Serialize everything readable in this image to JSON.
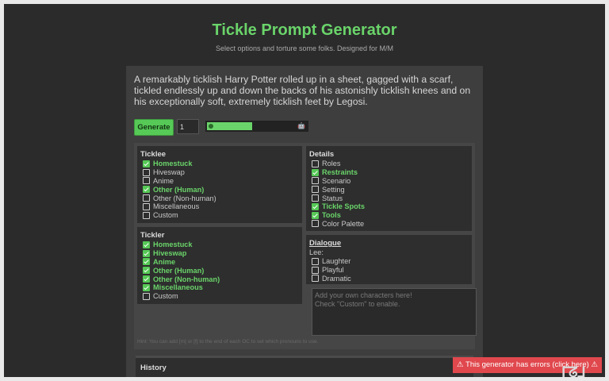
{
  "header": {
    "title": "Tickle Prompt Generator",
    "subtitle": "Select options and torture some folks. Designed for M/M"
  },
  "output": {
    "text": "A remarkably ticklish Harry Potter rolled up in a sheet, gagged with a scarf, tickled endlessly up and down the backs of his astonishly ticklish knees and on his exceptionally soft, extremely ticklish feet by Legosi."
  },
  "controls": {
    "generate_label": "Generate",
    "count_value": "1",
    "progress_fraction": 0.45
  },
  "ticklee": {
    "heading": "Ticklee",
    "items": [
      {
        "label": "Homestuck",
        "checked": true
      },
      {
        "label": "Hiveswap",
        "checked": false
      },
      {
        "label": "Anime",
        "checked": false
      },
      {
        "label": "Other (Human)",
        "checked": true
      },
      {
        "label": "Other (Non-human)",
        "checked": false
      },
      {
        "label": "Miscellaneous",
        "checked": false
      },
      {
        "label": "Custom",
        "checked": false
      }
    ]
  },
  "tickler": {
    "heading": "Tickler",
    "items": [
      {
        "label": "Homestuck",
        "checked": true
      },
      {
        "label": "Hiveswap",
        "checked": true
      },
      {
        "label": "Anime",
        "checked": true
      },
      {
        "label": "Other (Human)",
        "checked": true
      },
      {
        "label": "Other (Non-human)",
        "checked": true
      },
      {
        "label": "Miscellaneous",
        "checked": true
      },
      {
        "label": "Custom",
        "checked": false
      }
    ]
  },
  "details": {
    "heading": "Details",
    "items": [
      {
        "label": "Roles",
        "checked": false
      },
      {
        "label": "Restraints",
        "checked": true
      },
      {
        "label": "Scenario",
        "checked": false
      },
      {
        "label": "Setting",
        "checked": false
      },
      {
        "label": "Status",
        "checked": false
      },
      {
        "label": "Tickle Spots",
        "checked": true
      },
      {
        "label": "Tools",
        "checked": true
      },
      {
        "label": "Color Palette",
        "checked": false
      }
    ]
  },
  "dialogue": {
    "heading": "Dialogue",
    "sublabel": "Lee:",
    "items": [
      {
        "label": "Laughter",
        "checked": false
      },
      {
        "label": "Playful",
        "checked": false
      },
      {
        "label": "Dramatic",
        "checked": false
      }
    ]
  },
  "custom_input": {
    "placeholder": "Add your own characters here!\nCheck \"Custom\" to enable."
  },
  "hint": "Hint: You can add [m] or [f] to the end of each OC to set which pronouns to use.",
  "history": {
    "heading": "History"
  },
  "error_banner": "⚠ This generator has errors (click here) ⚠",
  "colors": {
    "accent": "#6ad46a",
    "panel": "#3e3e3e",
    "error": "#e0484d"
  }
}
